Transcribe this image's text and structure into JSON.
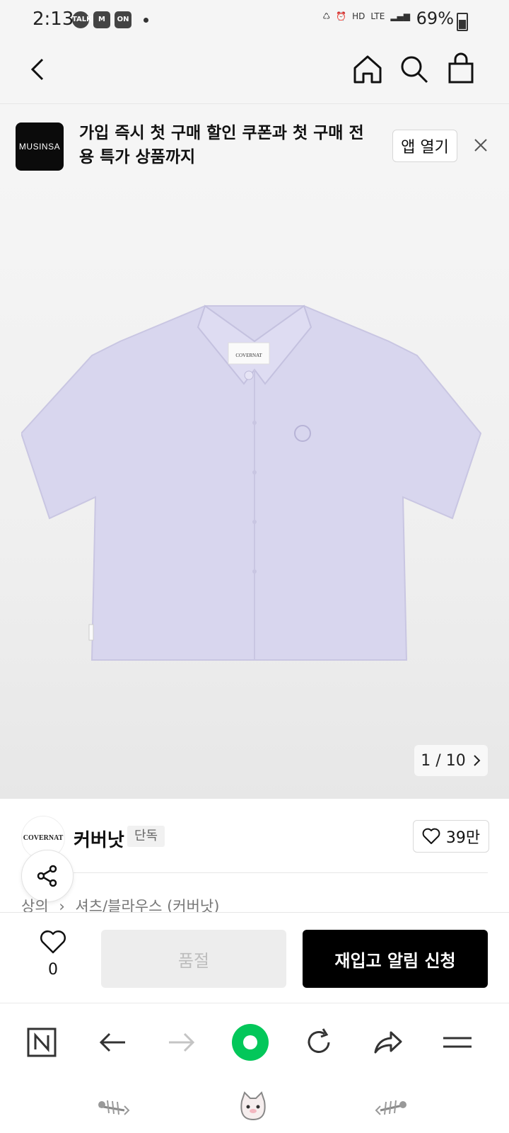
{
  "status_bar": {
    "time": "2:13",
    "notifications": [
      "TALK",
      "M",
      "ON"
    ],
    "network": "LTE",
    "battery": "69%"
  },
  "banner": {
    "logo_text": "MUSINSA",
    "message": "가입 즉시 첫 구매 할인 쿠폰과 첫 구매 전용 특가 상품까지",
    "open_app_label": "앱 열기"
  },
  "product_image": {
    "counter": "1 / 10",
    "tag_text": "COVERNAT",
    "shirt_color": "#d8d6ee"
  },
  "brand": {
    "logo_text": "COVERNAT",
    "name": "커버낫",
    "badge": "단독",
    "like_count": "39만"
  },
  "breadcrumb": {
    "items": [
      "상의",
      "셔츠/블라우스 (커버낫)"
    ]
  },
  "purchase_bar": {
    "wish_count": "0",
    "soldout_label": "품절",
    "restock_label": "재입고 알림 신청"
  },
  "browser_toolbar": {
    "naver_label": "N",
    "accent_color": "#03c75a"
  },
  "bottom_nav": {
    "icons": [
      "fishbone-icon",
      "cat-face-icon",
      "fishbone-icon"
    ]
  }
}
